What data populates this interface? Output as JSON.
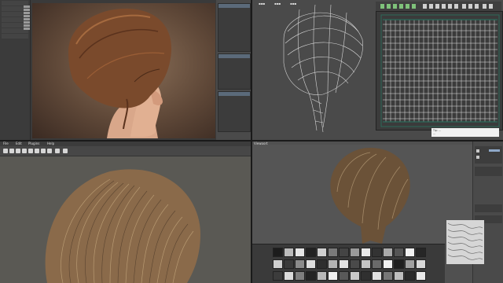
{
  "bottom_left": {
    "menu": [
      "File",
      "Edit",
      "Plugins",
      "Help"
    ]
  },
  "bottom_right": {
    "viewport_menu": "Viewport"
  },
  "top_right": {
    "tooltip_lines": [
      "Tip: ...",
      "..."
    ]
  },
  "icons": {
    "tool_icons": [
      "select-icon",
      "move-icon",
      "rotate-icon",
      "scale-icon",
      "brush-icon",
      "comb-icon",
      "cut-icon",
      "clump-icon",
      "smooth-icon",
      "settings-icon"
    ]
  },
  "colors": {
    "hair_brown": "#7a4a2c",
    "hair_tan": "#8a6a4a",
    "wire": "#d8d8d8",
    "uv_grid": "#e8e8e8",
    "uv_border": "#2b6a5a"
  }
}
